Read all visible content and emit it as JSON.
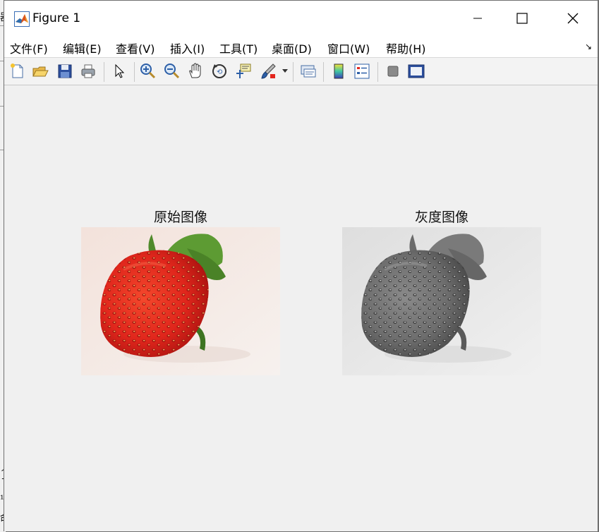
{
  "window": {
    "title": "Figure 1"
  },
  "menu": {
    "items": [
      "文件(F)",
      "编辑(E)",
      "查看(V)",
      "插入(I)",
      "工具(T)",
      "桌面(D)",
      "窗口(W)",
      "帮助(H)"
    ],
    "overflow_arrow": "↘"
  },
  "toolbar": {
    "buttons": [
      "new-figure-icon",
      "open-file-icon",
      "save-icon",
      "print-icon",
      "pointer-icon",
      "zoom-in-icon",
      "zoom-out-icon",
      "pan-hand-icon",
      "rotate-3d-icon",
      "data-cursor-icon",
      "brush-icon",
      "link-plot-icon",
      "colorbar-icon",
      "legend-icon",
      "hide-plot-tools-icon",
      "show-plot-tools-icon"
    ]
  },
  "figure": {
    "left_title": "原始图像",
    "right_title": "灰度图像"
  },
  "colors": {
    "strawberry_red": "#e3261e",
    "leaf_green": "#4f8a2b",
    "image_bg": "#f3e8e2",
    "gray_bg": "#e6e6e6"
  }
}
